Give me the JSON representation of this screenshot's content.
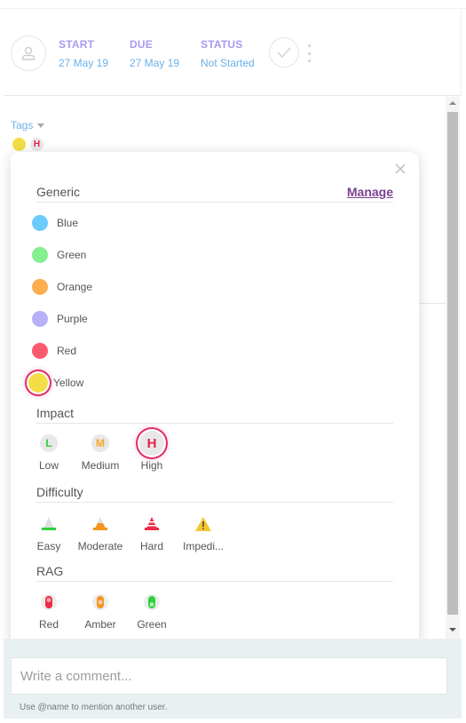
{
  "header": {
    "start": {
      "label": "START",
      "value": "27 May 19"
    },
    "due": {
      "label": "DUE",
      "value": "27 May 19"
    },
    "status": {
      "label": "STATUS",
      "value": "Not Started"
    }
  },
  "tags": {
    "label": "Tags",
    "selected_chips": [
      {
        "type": "color",
        "name": "Yellow",
        "color": "#f4de47"
      },
      {
        "type": "impact",
        "letter": "H",
        "color": "#e8204a"
      }
    ]
  },
  "popup": {
    "manage_label": "Manage",
    "generic": {
      "title": "Generic",
      "items": [
        {
          "label": "Blue",
          "color": "#6ccafc",
          "selected": false
        },
        {
          "label": "Green",
          "color": "#84f08f",
          "selected": false
        },
        {
          "label": "Orange",
          "color": "#fdae4f",
          "selected": false
        },
        {
          "label": "Purple",
          "color": "#b8b1fa",
          "selected": false
        },
        {
          "label": "Red",
          "color": "#fb5a6e",
          "selected": false
        },
        {
          "label": "Yellow",
          "color": "#f4de47",
          "selected": true
        }
      ]
    },
    "impact": {
      "title": "Impact",
      "items": [
        {
          "label": "Low",
          "letter": "L",
          "color": "#2ed13a",
          "selected": false
        },
        {
          "label": "Medium",
          "letter": "M",
          "color": "#f5a623",
          "selected": false
        },
        {
          "label": "High",
          "letter": "H",
          "color": "#e8204a",
          "selected": true
        }
      ]
    },
    "difficulty": {
      "title": "Difficulty",
      "items": [
        {
          "label": "Easy",
          "icon": "cone-easy-icon",
          "color": "#2ed13a"
        },
        {
          "label": "Moderate",
          "icon": "cone-moderate-icon",
          "color": "#f5941e"
        },
        {
          "label": "Hard",
          "icon": "cone-hard-icon",
          "color": "#ef2944"
        },
        {
          "label": "Impedi...",
          "icon": "warning-icon",
          "color": "#f7c531"
        }
      ]
    },
    "rag": {
      "title": "RAG",
      "items": [
        {
          "label": "Red",
          "color": "#ef2944"
        },
        {
          "label": "Amber",
          "color": "#f5941e"
        },
        {
          "label": "Green",
          "color": "#2ed13a"
        }
      ]
    }
  },
  "comment": {
    "placeholder": "Write a comment...",
    "value": "",
    "hint": "Use @name to mention another user."
  }
}
